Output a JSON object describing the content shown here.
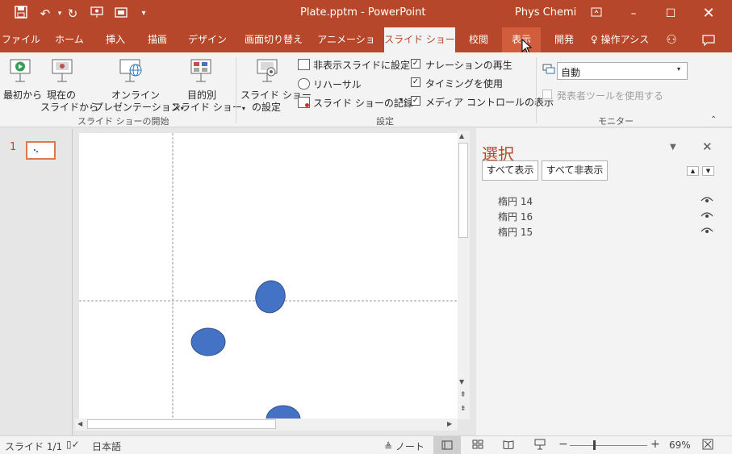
{
  "title": {
    "document": "Plate.pptm",
    "separator": "-",
    "app": "PowerPoint",
    "user": "Phys Chemi"
  },
  "tabs": [
    "ファイル",
    "ホーム",
    "挿入",
    "描画",
    "デザイン",
    "画面切り替え",
    "アニメーション",
    "スライド ショー",
    "校閲",
    "表示",
    "開発",
    "操作アシス"
  ],
  "ribbon": {
    "start_group": {
      "label": "スライド ショーの開始",
      "from_beginning": [
        "最初から"
      ],
      "from_current": [
        "現在の",
        "スライドから"
      ],
      "online": [
        "オンライン",
        "プレゼンテーション"
      ],
      "custom": [
        "目的別",
        "スライド ショー"
      ]
    },
    "setup_group": {
      "label": "設定",
      "setup": [
        "スライド ショー",
        "の設定"
      ],
      "hide_slide": "非表示スライドに設定",
      "rehearse": "リハーサル",
      "record": "スライド ショーの記録",
      "narration": "ナレーションの再生",
      "timing": "タイミングを使用",
      "media": "メディア コントロールの表示"
    },
    "monitor_group": {
      "label": "モニター",
      "monitor_value": "自動",
      "presenter": "発表者ツールを使用する"
    }
  },
  "thumb": {
    "number": "1"
  },
  "selection_pane": {
    "title": "選択",
    "show_all": "すべて表示",
    "hide_all": "すべて非表示",
    "items": [
      "楕円 14",
      "楕円 16",
      "楕円 15"
    ]
  },
  "status": {
    "slide": "スライド 1/1",
    "language": "日本語",
    "notes": "ノート",
    "zoom": "69%"
  },
  "colors": {
    "accent": "#b7472a",
    "shape_fill": "#4472c4"
  }
}
